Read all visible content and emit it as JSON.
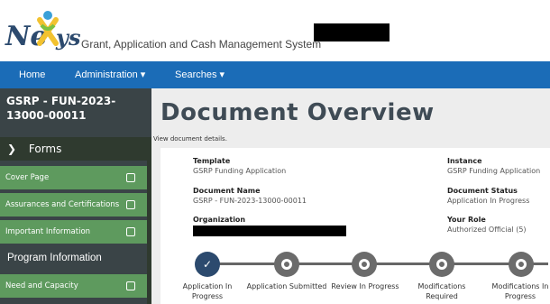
{
  "header": {
    "logo_text": "NeXSys",
    "tagline": "Grant, Application and Cash Management System"
  },
  "nav": {
    "items": [
      {
        "label": "Home"
      },
      {
        "label": "Administration ▾"
      },
      {
        "label": "Searches ▾"
      }
    ]
  },
  "sidebar": {
    "document_id": "GSRP - FUN-2023-13000-00011",
    "forms_label": "Forms",
    "forms_icon": "chevron-down-icon",
    "items": [
      {
        "label": "Cover Page"
      },
      {
        "label": "Assurances and Certifications"
      },
      {
        "label": "Important Information"
      }
    ],
    "section_label": "Program Information",
    "section_items": [
      {
        "label": "Need and Capacity"
      }
    ]
  },
  "main": {
    "title": "Document Overview",
    "subtitle": "View document details.",
    "fields": {
      "template_label": "Template",
      "template_value": "GSRP Funding Application",
      "instance_label": "Instance",
      "instance_value": "GSRP Funding Application",
      "docname_label": "Document Name",
      "docname_value": "GSRP - FUN-2023-13000-00011",
      "status_label": "Document Status",
      "status_value": "Application In Progress",
      "org_label": "Organization",
      "role_label": "Your Role",
      "role_value": "Authorized Official (5)"
    },
    "steps": [
      {
        "line1": "Application In",
        "line2": "Progress",
        "status": "completed"
      },
      {
        "line1": "Application Submitted",
        "line2": "",
        "status": "pending"
      },
      {
        "line1": "Review In Progress",
        "line2": "",
        "status": "pending"
      },
      {
        "line1": "Modifications",
        "line2": "Required",
        "status": "pending"
      },
      {
        "line1": "Modifications In",
        "line2": "Progress",
        "status": "pending"
      }
    ]
  },
  "colors": {
    "nav_blue": "#1b6cb7",
    "sidebar_green": "#5e9a5e",
    "sidebar_dark": "#3a4447",
    "step_done": "#2c4a6e"
  }
}
